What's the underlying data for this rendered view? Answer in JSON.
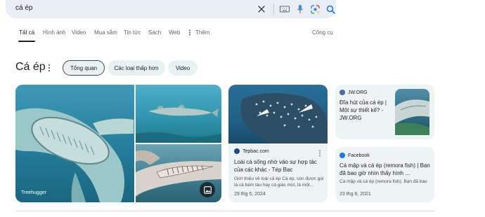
{
  "search": {
    "query": "cá ép"
  },
  "search_icons": [
    "close-icon",
    "keyboard-icon",
    "microphone-icon",
    "google-lens-icon",
    "search-icon"
  ],
  "tabs": [
    {
      "label": "Tất cả",
      "active": true
    },
    {
      "label": "Hình ảnh"
    },
    {
      "label": "Video"
    },
    {
      "label": "Mua sắm"
    },
    {
      "label": "Tin tức"
    },
    {
      "label": "Sách"
    },
    {
      "label": "Web"
    },
    {
      "label": "Thêm"
    }
  ],
  "tools": {
    "label": "Công cụ"
  },
  "heading": {
    "title": "Cá ép"
  },
  "chips": [
    {
      "label": "Tổng quan",
      "selected": true
    },
    {
      "label": "Các loại thấp hơn"
    },
    {
      "label": "Video"
    }
  ],
  "images": {
    "main_source": "Treehugger"
  },
  "results": [
    {
      "source": "Tepbac.com",
      "title": "Loài cá sống nhờ vào sự hợp tác của các khác - Tép Bạc",
      "snippet": "Giới thiệu về loài cá ép Cá ép, còn được gọi là cá bám tàu hay cá giác mút, là một...",
      "date": "29 thg 5, 2024"
    },
    {
      "source": "JW.ORG",
      "title": "Đĩa hút của cá ép | Một sự thiết kế? - JW.ORG"
    },
    {
      "source": "Facebook",
      "title": "Cá mập và cá ép (remora fish) | Bạn đã bao giờ nhìn thấy hình ...",
      "snippet": "Cá mập và cá ép (remora fish). Bạn đã bao",
      "date": "23 thg 6, 2021"
    }
  ],
  "colors": {
    "accent_blue": "#1a73e8",
    "search_bg": "#e9eef6",
    "card_bg": "#eef4f4"
  }
}
